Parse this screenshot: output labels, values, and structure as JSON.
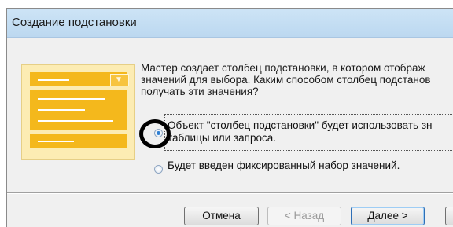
{
  "window": {
    "title": "Создание подстановки"
  },
  "description": "Мастер создает столбец подстановки, в котором отображ значений для выбора. Каким способом столбец подстанов получать эти значения?",
  "options": [
    {
      "text": "Объект \"столбец подстановки\" будет использовать зн таблицы или запроса.",
      "selected": true
    },
    {
      "text": "Будет введен фиксированный набор значений.",
      "selected": false
    }
  ],
  "buttons": {
    "cancel": "Отмена",
    "back": "< Назад",
    "next": "Далее >"
  },
  "colors": {
    "title_bg": "#c4ddf3",
    "illustration_bg": "#fcecb3",
    "illustration_bar": "#f4b81c"
  }
}
